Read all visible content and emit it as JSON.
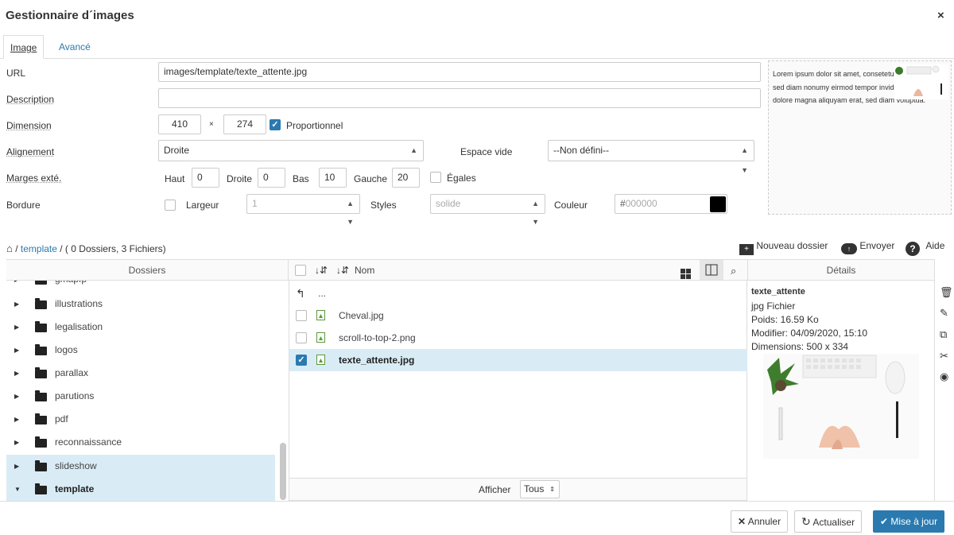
{
  "header": {
    "title": "Gestionnaire d´images",
    "close": "×"
  },
  "tabs": [
    {
      "label": "Image"
    },
    {
      "label": "Avancé"
    }
  ],
  "form": {
    "url_label": "URL",
    "url_value": "images/template/texte_attente.jpg",
    "description_label": "Description",
    "description_value": "",
    "dimension_label": "Dimension",
    "width": "410",
    "times": "×",
    "height": "274",
    "proportional_label": "Proportionnel",
    "alignment_label": "Alignement",
    "alignment_value": "Droite",
    "space_label": "Espace vide",
    "space_value": "--Non défini--",
    "margins_label": "Marges exté.",
    "top_label": "Haut",
    "top_value": "0",
    "right_label": "Droite",
    "right_value": "0",
    "bottom_label": "Bas",
    "bottom_value": "10",
    "left_label": "Gauche",
    "left_value": "20",
    "equal_label": "Égales",
    "border_label": "Bordure",
    "width_label": "Largeur",
    "border_width_value": "1",
    "styles_label": "Styles",
    "styles_value": "solide",
    "color_label": "Couleur",
    "color_prefix": "#",
    "color_value": "000000",
    "color_swatch": "#000000"
  },
  "preview": {
    "text": "Lorem ipsum dolor sit amet, consetetur sadipscing elitr, sed diam nonumy eirmod tempor invidunt ut labore et dolore magna aliquyam erat, sed diam voluptua."
  },
  "browser": {
    "breadcrumb_sep": "/",
    "breadcrumb_folder": "template",
    "breadcrumb_count": "/ ( 0 Dossiers, 3 Fichiers)",
    "new_folder": "Nouveau dossier",
    "upload": "Envoyer",
    "help": "Aide",
    "folders_header": "Dossiers",
    "name_header": "Nom",
    "details_header": "Détails",
    "folders": [
      {
        "name": "gmapfp"
      },
      {
        "name": "illustrations"
      },
      {
        "name": "legalisation"
      },
      {
        "name": "logos"
      },
      {
        "name": "parallax"
      },
      {
        "name": "parutions"
      },
      {
        "name": "pdf"
      },
      {
        "name": "reconnaissance"
      },
      {
        "name": "slideshow"
      },
      {
        "name": "template"
      }
    ],
    "parent": "...",
    "files": [
      {
        "name": "Cheval.jpg"
      },
      {
        "name": "scroll-to-top-2.png"
      },
      {
        "name": "texte_attente.jpg"
      }
    ],
    "show_label": "Afficher",
    "show_value": "Tous"
  },
  "details": {
    "name": "texte_attente",
    "type": "jpg Fichier",
    "weight": "Poids: 16.59 Ko",
    "modified": "Modifier: 04/09/2020, 15:10",
    "dimensions": "Dimensions: 500 x 334"
  },
  "footer": {
    "cancel": "Annuler",
    "refresh": "Actualiser",
    "update": "Mise à jour"
  }
}
